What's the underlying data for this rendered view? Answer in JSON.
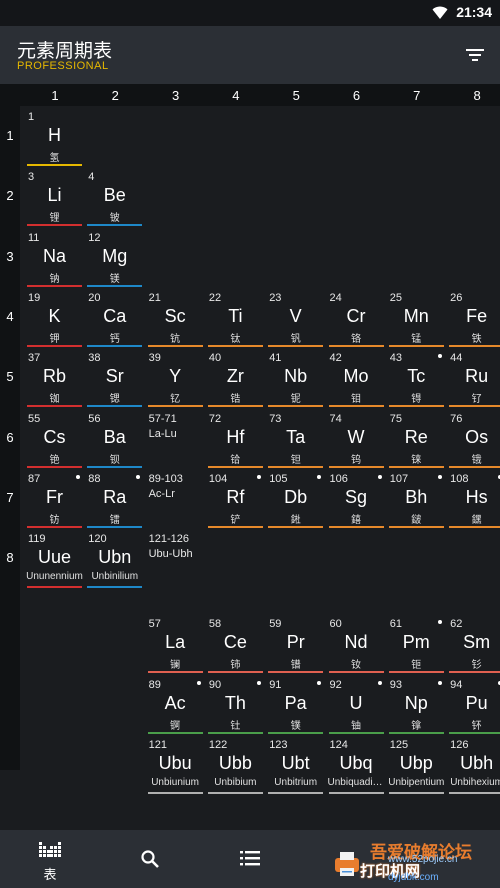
{
  "status_bar": {
    "time": "21:34",
    "wifi_icon": "wifi-icon"
  },
  "app_bar": {
    "title": "元素周期表",
    "subtitle": "PROFESSIONAL",
    "filter_icon": "filter-icon"
  },
  "colors": {
    "nonmetal": "#e6b800",
    "alkali": "#d32f2f",
    "alkaline_earth": "#1e88c8",
    "transition": "#e6892b",
    "lanthanide": "#e06050",
    "actinide": "#4a9e4a",
    "unknown": "#b0b0b0",
    "subtitle": "#e6b800"
  },
  "groups": [
    "1",
    "2",
    "3",
    "4",
    "5",
    "6",
    "7",
    "8"
  ],
  "periods": [
    "1",
    "2",
    "3",
    "4",
    "5",
    "6",
    "7",
    "8"
  ],
  "elements": [
    {
      "num": "1",
      "sym": "H",
      "name": "氢",
      "col": 0,
      "row": 0,
      "cat": "nonmetal"
    },
    {
      "num": "3",
      "sym": "Li",
      "name": "锂",
      "col": 0,
      "row": 1,
      "cat": "alkali"
    },
    {
      "num": "4",
      "sym": "Be",
      "name": "铍",
      "col": 1,
      "row": 1,
      "cat": "alkaline_earth"
    },
    {
      "num": "11",
      "sym": "Na",
      "name": "钠",
      "col": 0,
      "row": 2,
      "cat": "alkali"
    },
    {
      "num": "12",
      "sym": "Mg",
      "name": "镁",
      "col": 1,
      "row": 2,
      "cat": "alkaline_earth"
    },
    {
      "num": "19",
      "sym": "K",
      "name": "钾",
      "col": 0,
      "row": 3,
      "cat": "alkali"
    },
    {
      "num": "20",
      "sym": "Ca",
      "name": "钙",
      "col": 1,
      "row": 3,
      "cat": "alkaline_earth"
    },
    {
      "num": "21",
      "sym": "Sc",
      "name": "钪",
      "col": 2,
      "row": 3,
      "cat": "transition"
    },
    {
      "num": "22",
      "sym": "Ti",
      "name": "钛",
      "col": 3,
      "row": 3,
      "cat": "transition"
    },
    {
      "num": "23",
      "sym": "V",
      "name": "钒",
      "col": 4,
      "row": 3,
      "cat": "transition"
    },
    {
      "num": "24",
      "sym": "Cr",
      "name": "铬",
      "col": 5,
      "row": 3,
      "cat": "transition"
    },
    {
      "num": "25",
      "sym": "Mn",
      "name": "锰",
      "col": 6,
      "row": 3,
      "cat": "transition"
    },
    {
      "num": "26",
      "sym": "Fe",
      "name": "铁",
      "col": 7,
      "row": 3,
      "cat": "transition"
    },
    {
      "num": "37",
      "sym": "Rb",
      "name": "铷",
      "col": 0,
      "row": 4,
      "cat": "alkali"
    },
    {
      "num": "38",
      "sym": "Sr",
      "name": "锶",
      "col": 1,
      "row": 4,
      "cat": "alkaline_earth"
    },
    {
      "num": "39",
      "sym": "Y",
      "name": "钇",
      "col": 2,
      "row": 4,
      "cat": "transition"
    },
    {
      "num": "40",
      "sym": "Zr",
      "name": "锆",
      "col": 3,
      "row": 4,
      "cat": "transition"
    },
    {
      "num": "41",
      "sym": "Nb",
      "name": "铌",
      "col": 4,
      "row": 4,
      "cat": "transition"
    },
    {
      "num": "42",
      "sym": "Mo",
      "name": "钼",
      "col": 5,
      "row": 4,
      "cat": "transition"
    },
    {
      "num": "43",
      "sym": "Tc",
      "name": "锝",
      "col": 6,
      "row": 4,
      "cat": "transition",
      "dot": true
    },
    {
      "num": "44",
      "sym": "Ru",
      "name": "钌",
      "col": 7,
      "row": 4,
      "cat": "transition"
    },
    {
      "num": "55",
      "sym": "Cs",
      "name": "铯",
      "col": 0,
      "row": 5,
      "cat": "alkali"
    },
    {
      "num": "56",
      "sym": "Ba",
      "name": "钡",
      "col": 1,
      "row": 5,
      "cat": "alkaline_earth"
    },
    {
      "num": "72",
      "sym": "Hf",
      "name": "铪",
      "col": 3,
      "row": 5,
      "cat": "transition"
    },
    {
      "num": "73",
      "sym": "Ta",
      "name": "钽",
      "col": 4,
      "row": 5,
      "cat": "transition"
    },
    {
      "num": "74",
      "sym": "W",
      "name": "钨",
      "col": 5,
      "row": 5,
      "cat": "transition"
    },
    {
      "num": "75",
      "sym": "Re",
      "name": "铼",
      "col": 6,
      "row": 5,
      "cat": "transition"
    },
    {
      "num": "76",
      "sym": "Os",
      "name": "锇",
      "col": 7,
      "row": 5,
      "cat": "transition"
    },
    {
      "num": "87",
      "sym": "Fr",
      "name": "钫",
      "col": 0,
      "row": 6,
      "cat": "alkali",
      "dot": true
    },
    {
      "num": "88",
      "sym": "Ra",
      "name": "镭",
      "col": 1,
      "row": 6,
      "cat": "alkaline_earth",
      "dot": true
    },
    {
      "num": "104",
      "sym": "Rf",
      "name": "铲",
      "col": 3,
      "row": 6,
      "cat": "transition",
      "dot": true
    },
    {
      "num": "105",
      "sym": "Db",
      "name": "𨧀",
      "col": 4,
      "row": 6,
      "cat": "transition",
      "dot": true
    },
    {
      "num": "106",
      "sym": "Sg",
      "name": "𨭎",
      "col": 5,
      "row": 6,
      "cat": "transition",
      "dot": true
    },
    {
      "num": "107",
      "sym": "Bh",
      "name": "𨨏",
      "col": 6,
      "row": 6,
      "cat": "transition",
      "dot": true
    },
    {
      "num": "108",
      "sym": "Hs",
      "name": "𨭆",
      "col": 7,
      "row": 6,
      "cat": "transition",
      "dot": true
    },
    {
      "num": "119",
      "sym": "Uue",
      "name": "Ununennium",
      "col": 0,
      "row": 7,
      "cat": "alkali",
      "latin": true
    },
    {
      "num": "120",
      "sym": "Ubn",
      "name": "Unbinilium",
      "col": 1,
      "row": 7,
      "cat": "alkaline_earth",
      "latin": true
    },
    {
      "num": "57",
      "sym": "La",
      "name": "镧",
      "col": 2,
      "row": 8,
      "cat": "lanthanide"
    },
    {
      "num": "58",
      "sym": "Ce",
      "name": "铈",
      "col": 3,
      "row": 8,
      "cat": "lanthanide"
    },
    {
      "num": "59",
      "sym": "Pr",
      "name": "镨",
      "col": 4,
      "row": 8,
      "cat": "lanthanide"
    },
    {
      "num": "60",
      "sym": "Nd",
      "name": "钕",
      "col": 5,
      "row": 8,
      "cat": "lanthanide"
    },
    {
      "num": "61",
      "sym": "Pm",
      "name": "钷",
      "col": 6,
      "row": 8,
      "cat": "lanthanide",
      "dot": true
    },
    {
      "num": "62",
      "sym": "Sm",
      "name": "钐",
      "col": 7,
      "row": 8,
      "cat": "lanthanide"
    },
    {
      "num": "89",
      "sym": "Ac",
      "name": "锕",
      "col": 2,
      "row": 9,
      "cat": "actinide",
      "dot": true
    },
    {
      "num": "90",
      "sym": "Th",
      "name": "钍",
      "col": 3,
      "row": 9,
      "cat": "actinide",
      "dot": true
    },
    {
      "num": "91",
      "sym": "Pa",
      "name": "镤",
      "col": 4,
      "row": 9,
      "cat": "actinide",
      "dot": true
    },
    {
      "num": "92",
      "sym": "U",
      "name": "铀",
      "col": 5,
      "row": 9,
      "cat": "actinide",
      "dot": true
    },
    {
      "num": "93",
      "sym": "Np",
      "name": "镎",
      "col": 6,
      "row": 9,
      "cat": "actinide",
      "dot": true
    },
    {
      "num": "94",
      "sym": "Pu",
      "name": "钚",
      "col": 7,
      "row": 9,
      "cat": "actinide",
      "dot": true
    },
    {
      "num": "121",
      "sym": "Ubu",
      "name": "Unbiunium",
      "col": 2,
      "row": 10,
      "cat": "unknown",
      "latin": true
    },
    {
      "num": "122",
      "sym": "Ubb",
      "name": "Unbibium",
      "col": 3,
      "row": 10,
      "cat": "unknown",
      "latin": true
    },
    {
      "num": "123",
      "sym": "Ubt",
      "name": "Unbitrium",
      "col": 4,
      "row": 10,
      "cat": "unknown",
      "latin": true
    },
    {
      "num": "124",
      "sym": "Ubq",
      "name": "Unbiquadium",
      "col": 5,
      "row": 10,
      "cat": "unknown",
      "latin": true
    },
    {
      "num": "125",
      "sym": "Ubp",
      "name": "Unbipentium",
      "col": 6,
      "row": 10,
      "cat": "unknown",
      "latin": true
    },
    {
      "num": "126",
      "sym": "Ubh",
      "name": "Unbihexium",
      "col": 7,
      "row": 10,
      "cat": "unknown",
      "latin": true
    }
  ],
  "ranges": [
    {
      "num": "57-71",
      "label": "La-Lu",
      "col": 2,
      "row": 5
    },
    {
      "num": "89-103",
      "label": "Ac-Lr",
      "col": 2,
      "row": 6
    },
    {
      "num": "121-126",
      "label": "Ubu-Ubh",
      "col": 2,
      "row": 7
    }
  ],
  "bottom_nav": {
    "table_label": "表",
    "table_icon": "periodic-table-icon",
    "search_icon": "search-icon",
    "list_icon": "list-icon"
  },
  "watermark": {
    "line1": "吾爱破解论坛",
    "line2": "打印机网",
    "url1": "www.52pojie.cn",
    "url2": "dyjdbk.com"
  }
}
